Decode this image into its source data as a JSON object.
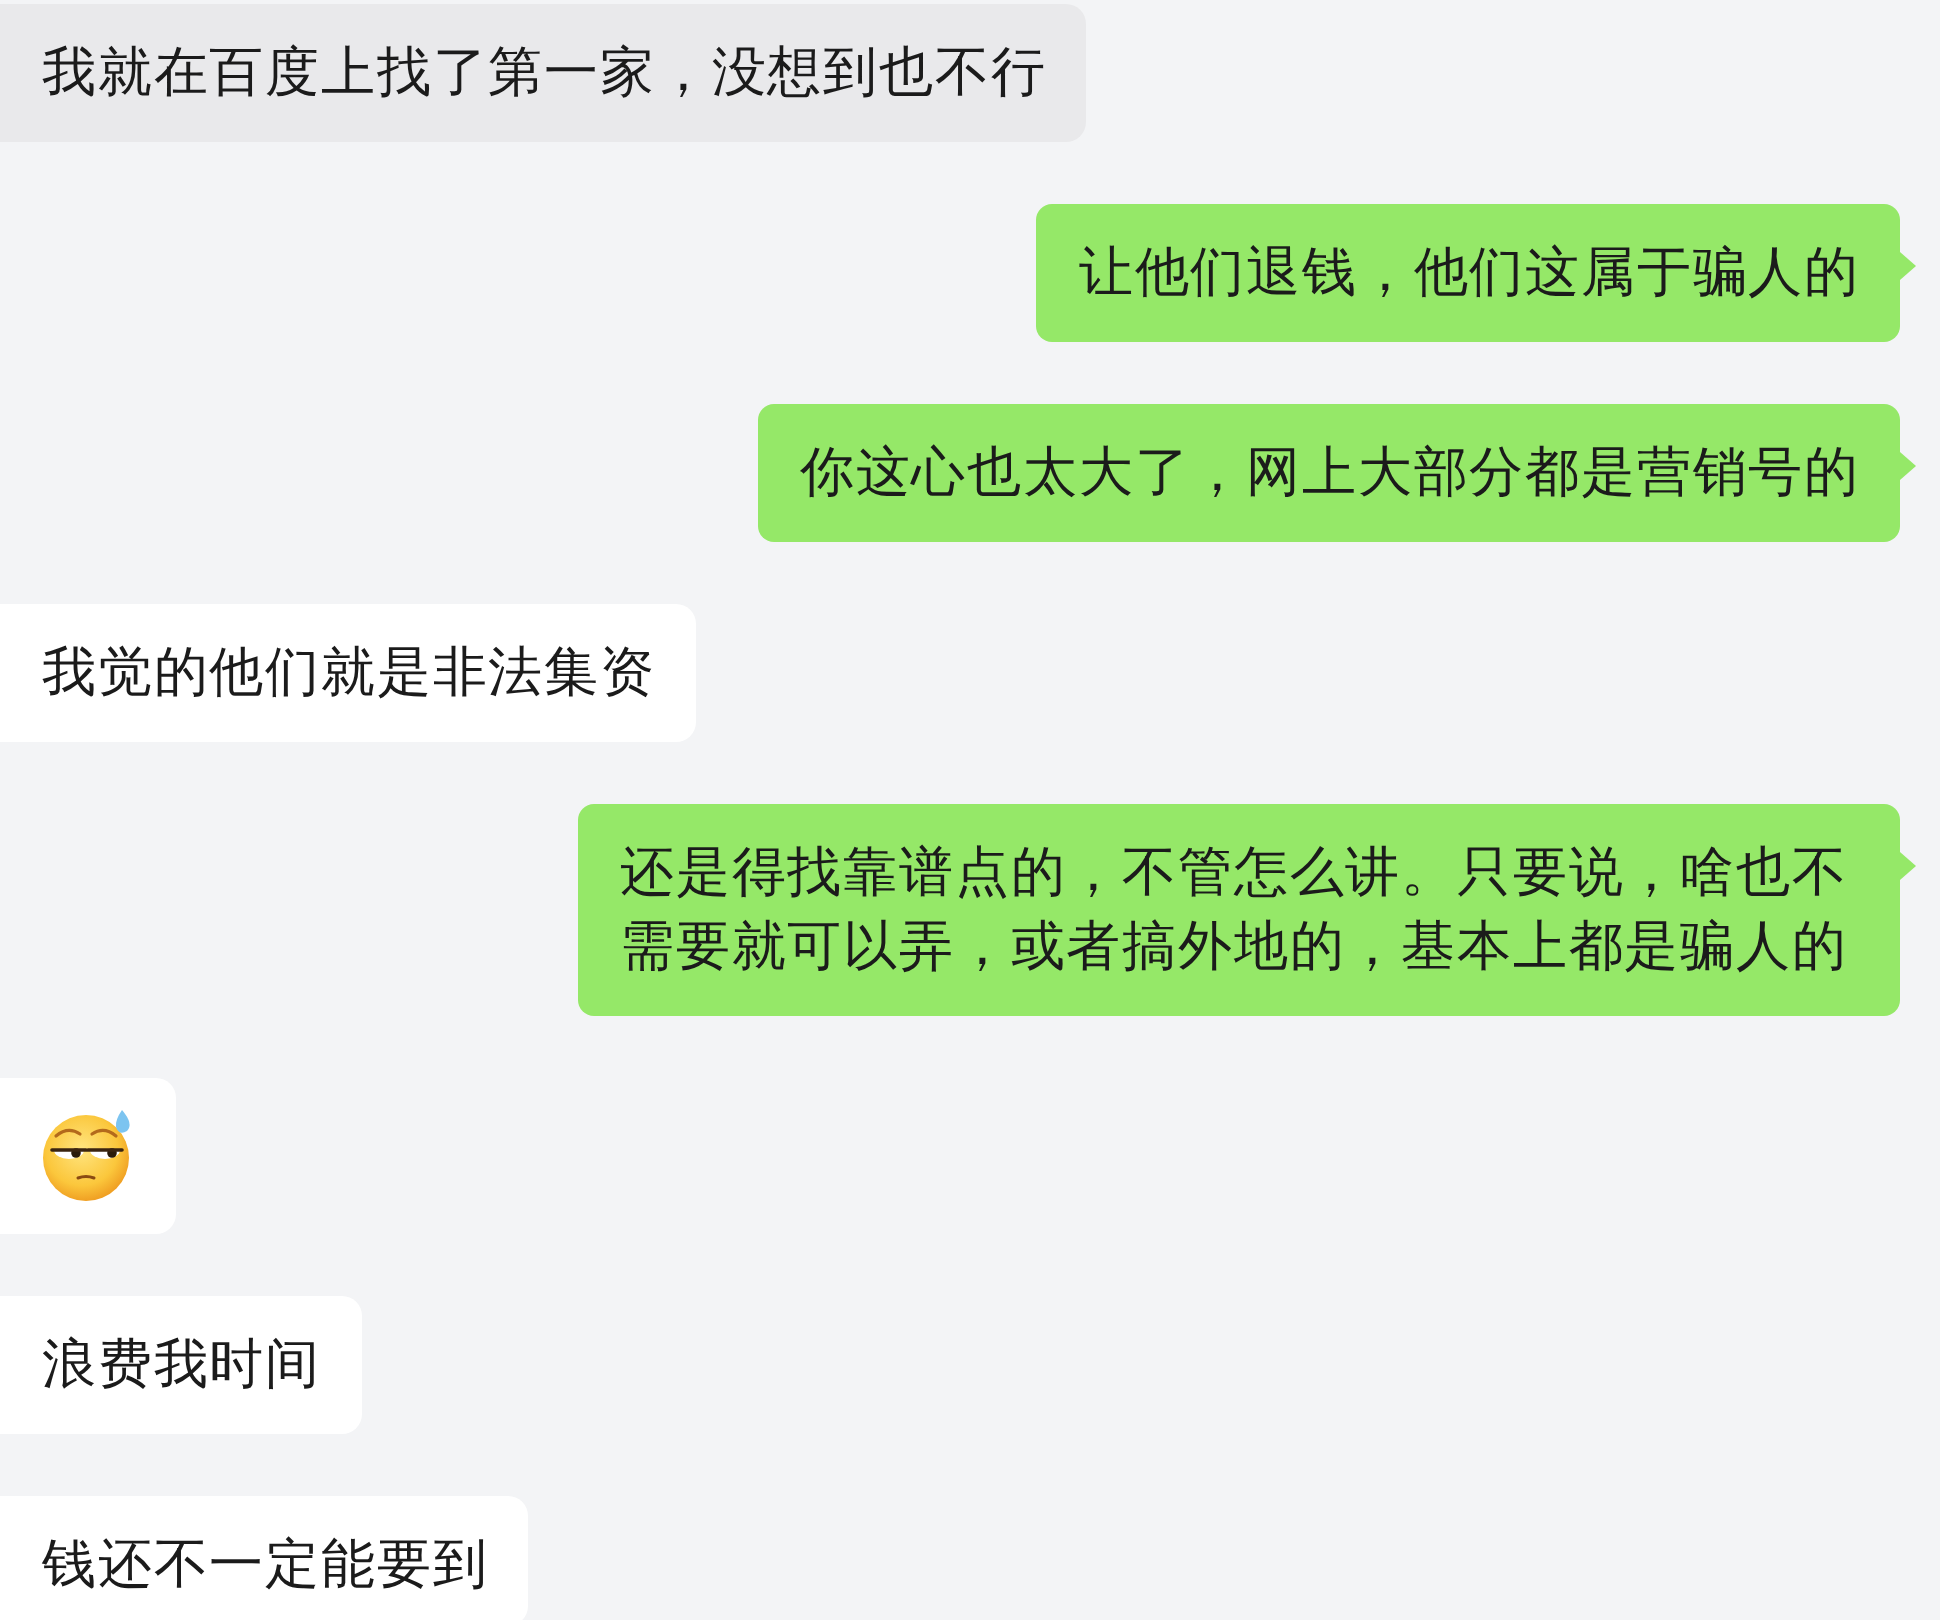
{
  "messages": [
    {
      "outgoing": false,
      "kind": "text",
      "highlighted": true,
      "text": "我就在百度上找了第一家，没想到也不行"
    },
    {
      "outgoing": true,
      "kind": "text",
      "highlighted": false,
      "text": "让他们退钱，他们这属于骗人的"
    },
    {
      "outgoing": true,
      "kind": "text",
      "highlighted": false,
      "text": "你这心也太大了，网上大部分都是营销号的"
    },
    {
      "outgoing": false,
      "kind": "text",
      "highlighted": false,
      "text": "我觉的他们就是非法集资"
    },
    {
      "outgoing": true,
      "kind": "text",
      "highlighted": false,
      "text": "还是得找靠谱点的，不管怎么讲。只要说，啥也不需要就可以弄，或者搞外地的，基本上都是骗人的"
    },
    {
      "outgoing": false,
      "kind": "emoji",
      "highlighted": false
    },
    {
      "outgoing": false,
      "kind": "text",
      "highlighted": false,
      "text": "浪费我时间"
    },
    {
      "outgoing": false,
      "kind": "text",
      "highlighted": false,
      "text": "钱还不一定能要到"
    }
  ]
}
